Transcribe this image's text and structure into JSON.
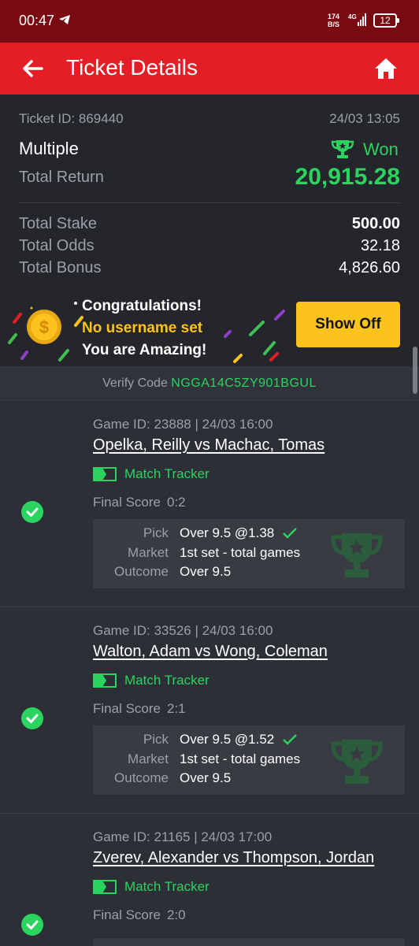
{
  "status_bar": {
    "time": "00:47",
    "net_speed_top": "174",
    "net_speed_bottom": "B/S",
    "network": "4G",
    "battery": "12"
  },
  "header": {
    "title": "Ticket Details"
  },
  "ticket": {
    "id_label": "Ticket ID: 869440",
    "datetime": "24/03 13:05",
    "type": "Multiple",
    "status": "Won",
    "total_return_label": "Total Return",
    "total_return": "20,915.28",
    "total_stake_label": "Total Stake",
    "total_stake": "500.00",
    "total_odds_label": "Total Odds",
    "total_odds": "32.18",
    "total_bonus_label": "Total Bonus",
    "total_bonus": "4,826.60"
  },
  "banner": {
    "line1": "Congratulations!",
    "line2": "No username set",
    "line3": "You are Amazing!",
    "button": "Show Off"
  },
  "verify": {
    "label": "Verify Code",
    "code": "NGGA14C5ZY901BGUL"
  },
  "games": [
    {
      "id": "Game ID: 23888 | 24/03 16:00",
      "teams": "Opelka, Reilly vs Machac, Tomas",
      "tracker": "Match Tracker",
      "final_label": "Final Score",
      "final": "0:2",
      "pick_label": "Pick",
      "pick": "Over 9.5 @1.38",
      "market_label": "Market",
      "market": "1st set - total games",
      "outcome_label": "Outcome",
      "outcome": "Over 9.5"
    },
    {
      "id": "Game ID: 33526 | 24/03 16:00",
      "teams": "Walton, Adam vs Wong, Coleman",
      "tracker": "Match Tracker",
      "final_label": "Final Score",
      "final": "2:1",
      "pick_label": "Pick",
      "pick": "Over 9.5 @1.52",
      "market_label": "Market",
      "market": "1st set - total games",
      "outcome_label": "Outcome",
      "outcome": "Over 9.5"
    },
    {
      "id": "Game ID: 21165 | 24/03 17:00",
      "teams": "Zverev, Alexander vs Thompson, Jordan",
      "tracker": "Match Tracker",
      "final_label": "Final Score",
      "final": "2:0",
      "pick_label": "",
      "pick": "",
      "market_label": "",
      "market": "",
      "outcome_label": "",
      "outcome": ""
    }
  ],
  "colors": {
    "brand_red": "#e41e26",
    "status_red": "#7a0a12",
    "win_green": "#2bd35f",
    "accent_yellow": "#fdc31d",
    "background": "#24262b"
  },
  "icons": [
    "back-arrow-icon",
    "home-icon",
    "trophy-icon",
    "coin-icon",
    "match-tracker-icon",
    "check-icon",
    "checkmark-icon"
  ]
}
